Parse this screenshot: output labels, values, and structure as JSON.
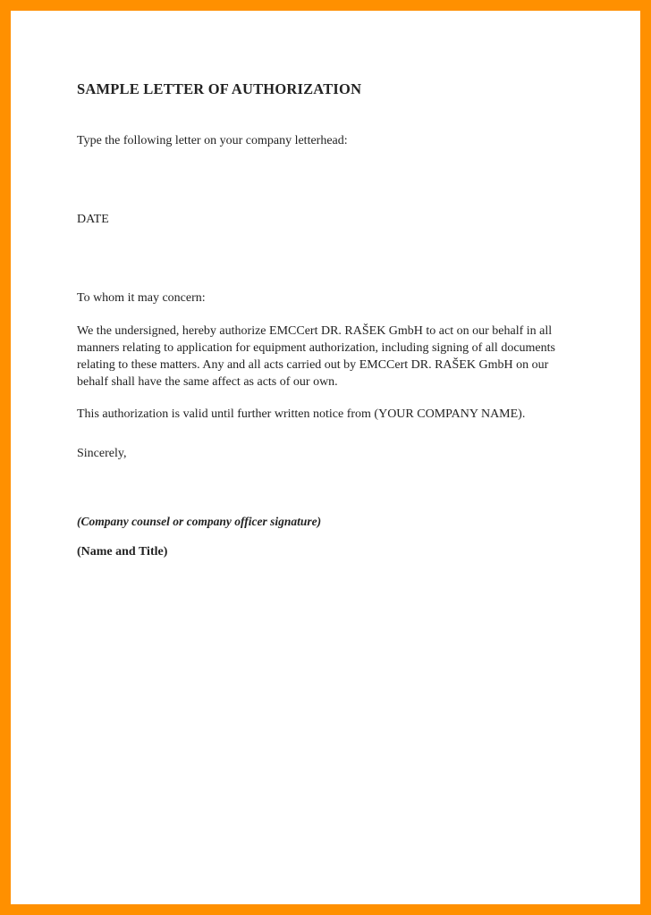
{
  "document": {
    "title": "SAMPLE LETTER OF AUTHORIZATION",
    "instruction": "Type the following letter on your company letterhead:",
    "date_label": "DATE",
    "salutation": "To whom it may concern:",
    "body_prefix": "We the undersigned, hereby authorize ",
    "company1": "EMCCert DR. RAŠEK GmbH",
    "body_middle": " to act on our behalf in all manners relating to application for equipment authorization, including signing of all documents relating to these matters.  Any and all acts carried out by ",
    "company2": "EMCCert DR. RAŠEK GmbH",
    "body_suffix": " on our behalf shall have the same affect as acts of our own.",
    "validity": "This authorization is valid until further written notice from (YOUR COMPANY NAME).",
    "closing": "Sincerely,",
    "signature_placeholder": "(Company counsel or company officer signature)",
    "name_title_placeholder": "(Name and Title)"
  }
}
